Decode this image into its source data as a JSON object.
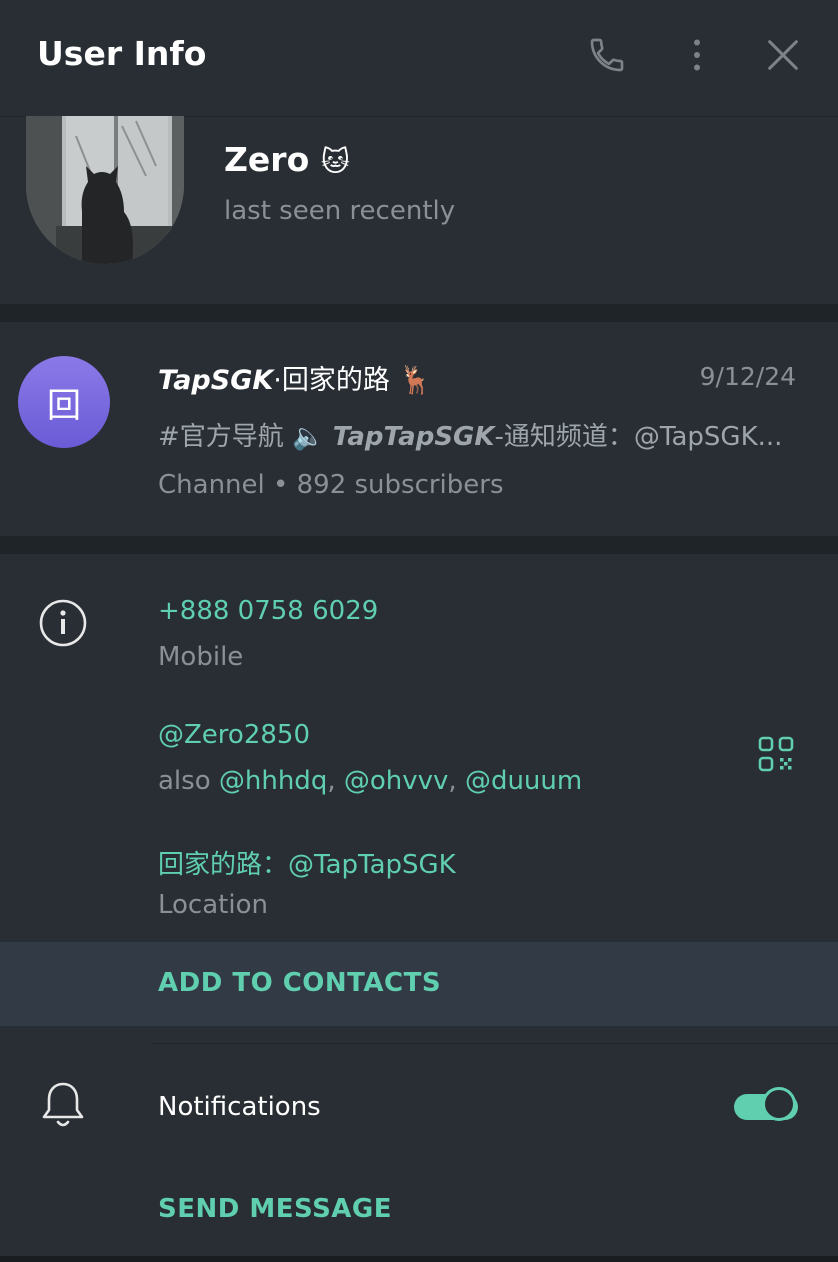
{
  "header": {
    "title": "User Info"
  },
  "profile": {
    "name": "Zero",
    "name_emoji": "🐱",
    "status": "last seen recently"
  },
  "channel": {
    "avatar_glyph": "回",
    "name_bold": "TapSGK",
    "name_rest": "·回家的路 🦌",
    "date": "9/12/24",
    "preview_prefix": "#官方导航  🔈 ",
    "preview_bold": "TapTapSGK",
    "preview_rest": "-通知频道：@TapSGK...",
    "meta": "Channel • 892 subscribers"
  },
  "info": {
    "phone": "+888 0758 6029",
    "phone_label": "Mobile",
    "username": "@Zero2850",
    "also_prefix": "also ",
    "also_1": "@hhhdq",
    "also_2": "@ohvvv",
    "also_3": "@duuum",
    "location_value": "回家的路：@TapTapSGK",
    "location_label": "Location"
  },
  "actions": {
    "add_contacts": "ADD TO CONTACTS",
    "notifications": "Notifications",
    "notifications_on": true,
    "send_message": "SEND MESSAGE"
  },
  "colors": {
    "accent": "#5fcfb0",
    "background": "#282e33",
    "separator": "#1f2428"
  }
}
